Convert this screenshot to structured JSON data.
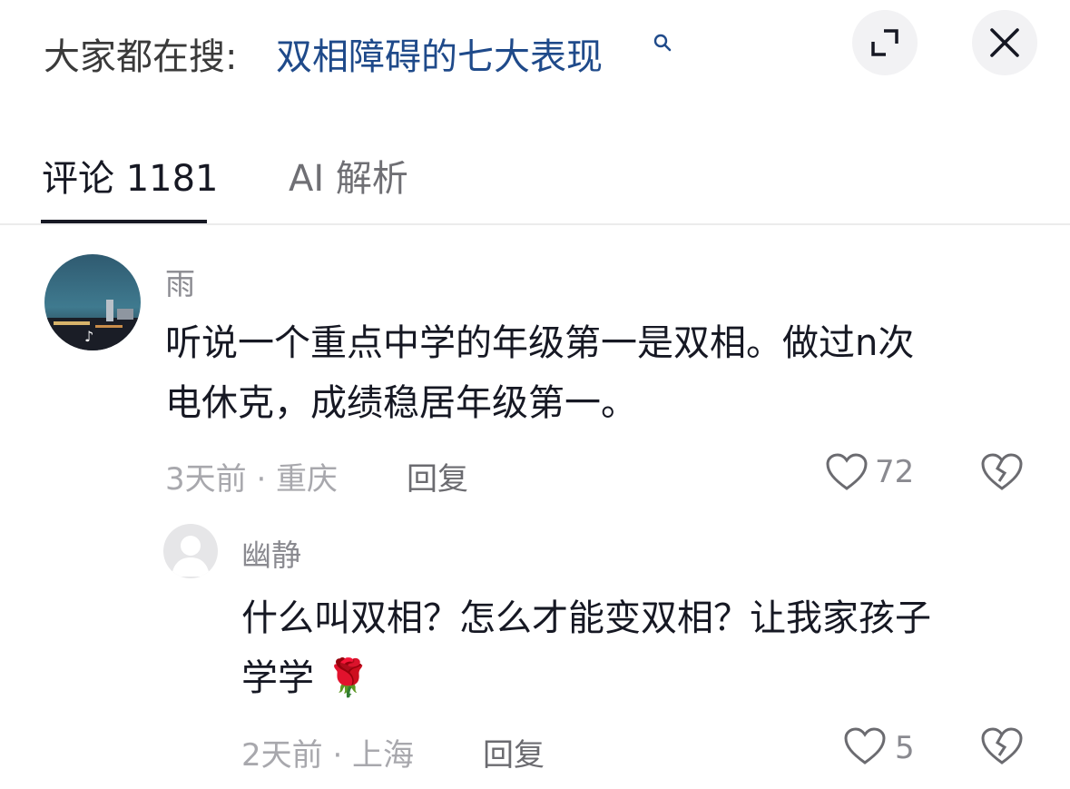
{
  "header": {
    "search_prefix": "大家都在搜:",
    "search_term": "双相障碍的七大表现",
    "icons": {
      "search": "search-icon",
      "expand": "expand-icon",
      "close": "close-icon"
    }
  },
  "tabs": [
    {
      "label": "评论 1181",
      "active": true
    },
    {
      "label": "AI 解析",
      "active": false
    }
  ],
  "comments": [
    {
      "username": "雨",
      "text_line1": "听说一个重点中学的年级第一是双相。做过n次",
      "text_line2": "电休克，成绩稳居年级第一。",
      "meta": "3天前 · 重庆",
      "reply_label": "回复",
      "likes": "72"
    }
  ],
  "replies": [
    {
      "username": "幽静",
      "text_line1": "什么叫双相？怎么才能变双相？让我家孩子",
      "text_line2": "学学",
      "emoji": "🌹",
      "meta": "2天前 · 上海",
      "reply_label": "回复",
      "likes": "5"
    }
  ],
  "colors": {
    "accent_link": "#1f4a8a",
    "text_primary": "#161823",
    "text_secondary": "#a8a8ad"
  }
}
